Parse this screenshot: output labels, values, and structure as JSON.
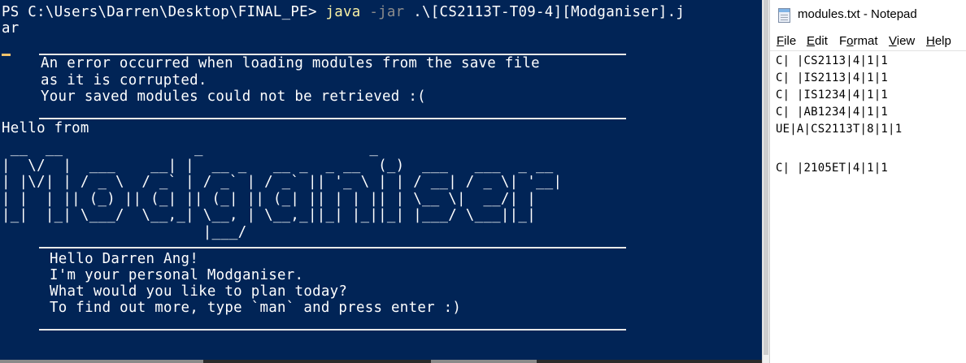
{
  "terminal": {
    "prompt_text": "PS C:\\Users\\Darren\\Desktop\\FINAL_PE> ",
    "command": "java",
    "option": "-jar",
    "jar_path_line1": ".\\[CS2113T-T09-4][Modganiser].j",
    "jar_path_line2": "ar",
    "error_lines": [
      "An error occurred when loading modules from the save file",
      "as it is corrupted.",
      "Your saved modules could not be retrieved :("
    ],
    "hello_from": "Hello from",
    "logo_ascii": " __  __               _                   _\n|  \\/  |  ___    __| |  __ _   __ _  _ __  (_)  ___   ___  _ __\n| |\\/| | / _ \\  / _` | / _` | / _` || '_ \\ | | / __| / _ \\| '__|\n| |  | || (_) || (_| || (_| || (_| || | | || | \\__ \\|  __/| |\n|_|  |_| \\___/  \\__,_| \\__, | \\__,_||_| |_||_| |___/ \\___||_|\n                       |___/",
    "welcome_lines": [
      "Hello Darren Ang!",
      "I'm your personal Modganiser.",
      "What would you like to plan today?",
      "To find out more, type `man` and press enter :)"
    ]
  },
  "notepad": {
    "title": "modules.txt - Notepad",
    "menu": [
      {
        "label": "File",
        "key": "F",
        "rest": "ile"
      },
      {
        "label": "Edit",
        "key": "E",
        "rest": "dit"
      },
      {
        "label": "Format",
        "pre": "F",
        "key": "o",
        "rest": "rmat"
      },
      {
        "label": "View",
        "key": "V",
        "rest": "iew"
      },
      {
        "label": "Help",
        "key": "H",
        "rest": "elp"
      }
    ],
    "lines": [
      "C| |CS2113|4|1|1",
      "C| |IS2113|4|1|1",
      "C| |IS1234|4|1|1",
      "C| |AB1234|4|1|1",
      "UE|A|CS2113T|8|1|1",
      "",
      "C| |2105ET|4|1|1"
    ]
  },
  "colors": {
    "terminal_bg": "#012456",
    "terminal_text": "#ffffff",
    "command_yellow": "#f9f1a5",
    "option_gray": "#8c8c8c",
    "notepad_bg": "#ffffff"
  },
  "icons": {
    "notepad_app": "notepad-icon"
  }
}
